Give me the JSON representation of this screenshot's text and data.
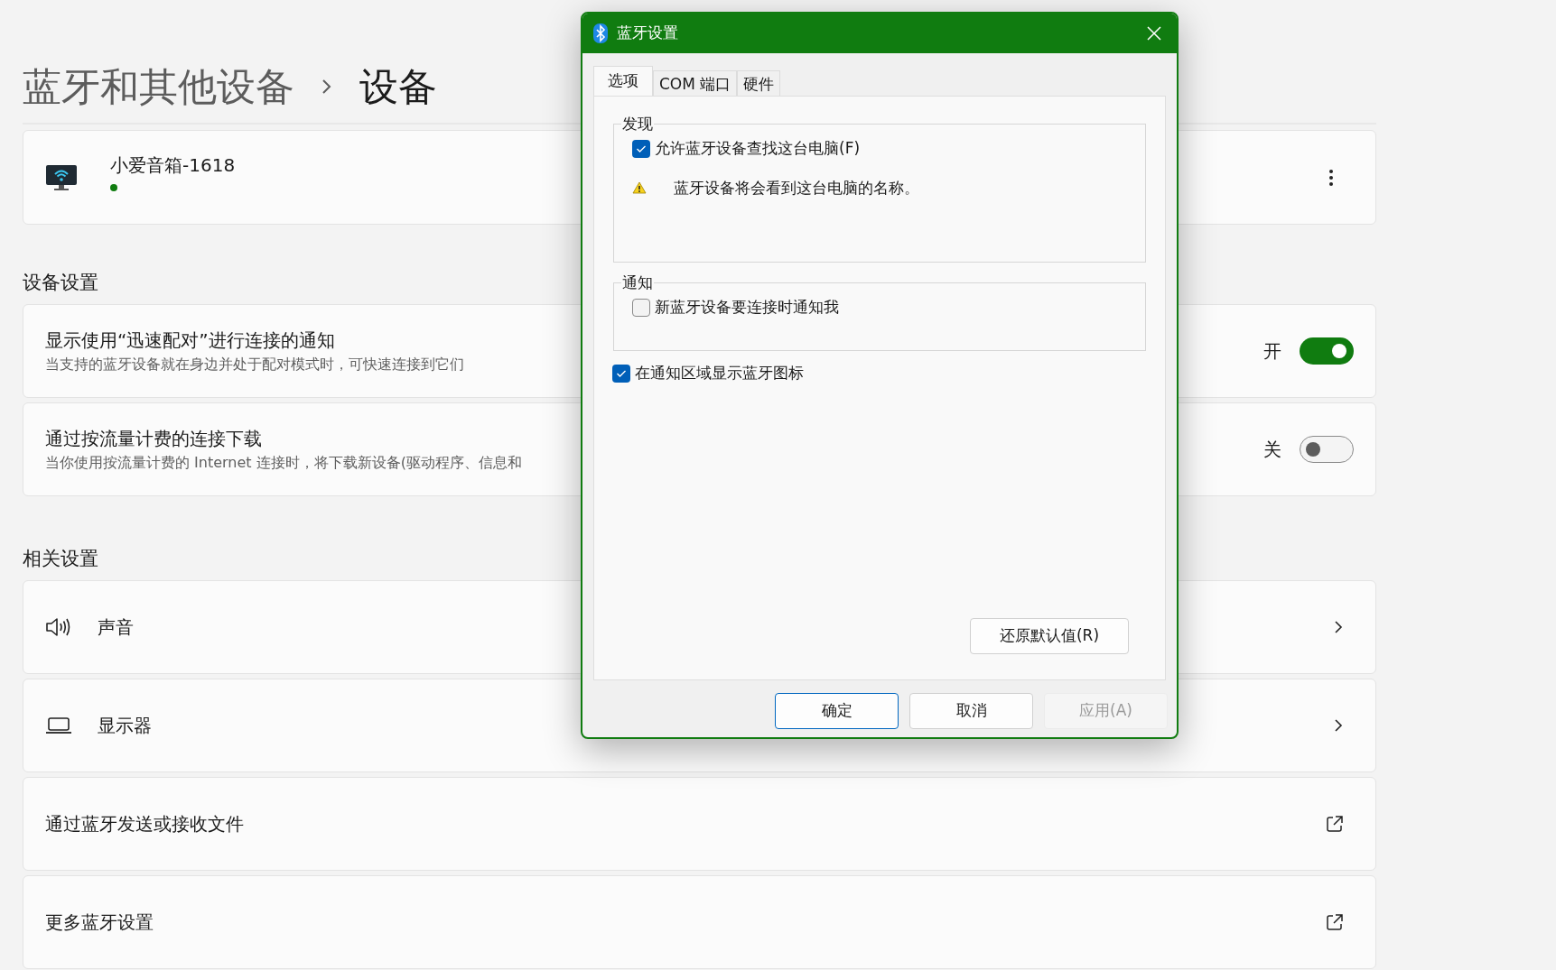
{
  "breadcrumb": [
    {
      "label": "蓝牙和其他设备",
      "current": false
    },
    {
      "label": "设备",
      "current": true
    }
  ],
  "device": {
    "name": "小爱音箱-1618",
    "connected": true
  },
  "sections": [
    {
      "title": "设备设置",
      "items": [
        {
          "kind": "toggle",
          "title": "显示使用“迅速配对”进行连接的通知",
          "description": "当支持的蓝牙设备就在身边并处于配对模式时，可快速连接到它们",
          "state_label": "开",
          "on": true
        },
        {
          "kind": "toggle",
          "title": "通过按流量计费的连接下载",
          "description": "当你使用按流量计费的 Internet 连接时，将下载新设备(驱动程序、信息和",
          "state_label": "关",
          "on": false
        }
      ]
    },
    {
      "title": "相关设置",
      "items": [
        {
          "kind": "nav",
          "title": "声音"
        },
        {
          "kind": "nav",
          "title": "显示器"
        },
        {
          "kind": "external",
          "title": "通过蓝牙发送或接收文件"
        },
        {
          "kind": "external",
          "title": "更多蓝牙设置"
        }
      ]
    }
  ],
  "dialog": {
    "title": "蓝牙设置",
    "tabs": [
      {
        "label": "选项",
        "selected": true
      },
      {
        "label": "COM 端口",
        "selected": false
      },
      {
        "label": "硬件",
        "selected": false
      }
    ],
    "groups": [
      {
        "legend": "发现",
        "options": [
          {
            "kind": "checkbox",
            "label": "允许蓝牙设备查找这台电脑(F)",
            "checked": true
          },
          {
            "kind": "warning",
            "label": "蓝牙设备将会看到这台电脑的名称。"
          }
        ]
      },
      {
        "legend": "通知",
        "options": [
          {
            "kind": "checkbox",
            "label": "新蓝牙设备要连接时通知我",
            "checked": false
          }
        ]
      }
    ],
    "extra_option": {
      "label": "在通知区域显示蓝牙图标",
      "checked": true
    },
    "restore_button": "还原默认值(R)",
    "buttons": [
      {
        "label": "确定",
        "default": true,
        "disabled": false
      },
      {
        "label": "取消",
        "default": false,
        "disabled": false
      },
      {
        "label": "应用(A)",
        "default": false,
        "disabled": true
      }
    ]
  }
}
